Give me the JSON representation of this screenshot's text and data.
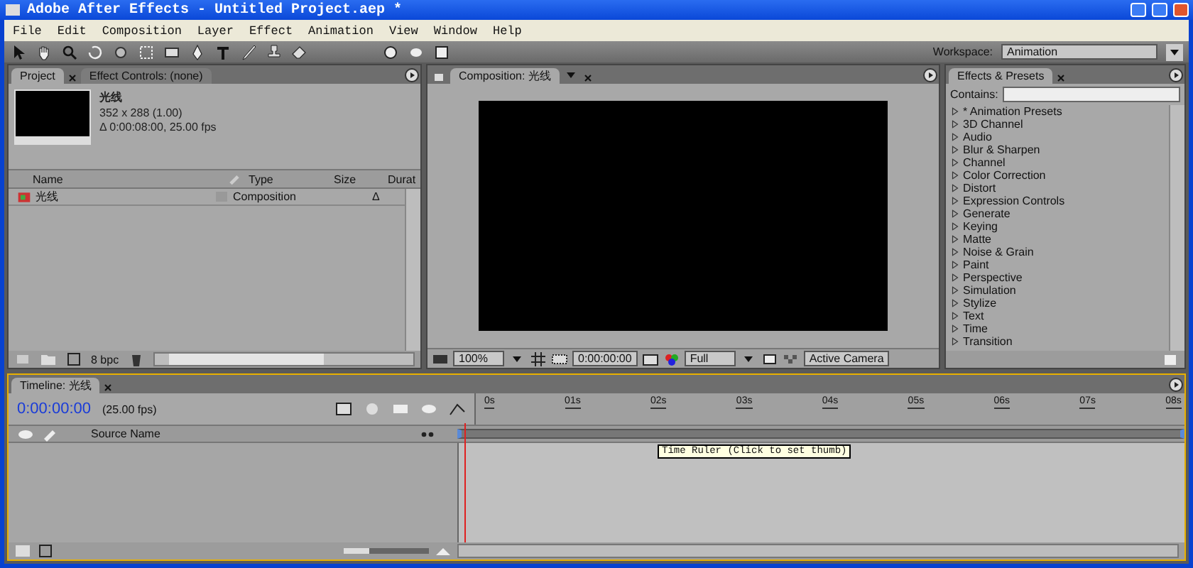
{
  "window": {
    "title": "Adobe After Effects - Untitled Project.aep *"
  },
  "menu": [
    "File",
    "Edit",
    "Composition",
    "Layer",
    "Effect",
    "Animation",
    "View",
    "Window",
    "Help"
  ],
  "workspace": {
    "label": "Workspace:",
    "value": "Animation"
  },
  "project_panel": {
    "tabs": [
      {
        "label": "Project",
        "selected": true
      },
      {
        "label": "Effect Controls: (none)",
        "selected": false
      }
    ],
    "item_name": "光线",
    "item_size": "352 x 288 (1.00)",
    "item_duration": "Δ 0:00:08:00, 25.00 fps",
    "columns": [
      "Name",
      "Type",
      "Size",
      "Durat"
    ],
    "rows": [
      {
        "name": "光线",
        "type": "Composition",
        "duration": "Δ"
      }
    ],
    "bit_depth": "8 bpc"
  },
  "composition_panel": {
    "tab": "Composition: 光线",
    "zoom": "100%",
    "timecode": "0:00:00:00",
    "resolution": "Full",
    "camera": "Active Camera"
  },
  "effects_panel": {
    "tab": "Effects & Presets",
    "search_label": "Contains:",
    "categories": [
      "* Animation Presets",
      "3D Channel",
      "Audio",
      "Blur & Sharpen",
      "Channel",
      "Color Correction",
      "Distort",
      "Expression Controls",
      "Generate",
      "Keying",
      "Matte",
      "Noise & Grain",
      "Paint",
      "Perspective",
      "Simulation",
      "Stylize",
      "Text",
      "Time",
      "Transition"
    ]
  },
  "timeline": {
    "tab": "Timeline: 光线",
    "timecode": "0:00:00:00",
    "fps": "(25.00 fps)",
    "source_column": "Source Name",
    "ruler_ticks": [
      "0s",
      "01s",
      "02s",
      "03s",
      "04s",
      "05s",
      "06s",
      "07s",
      "08s"
    ],
    "tooltip": "Time Ruler (Click to set thumb)",
    "zoom_slider": {
      "level": 0.3
    }
  }
}
